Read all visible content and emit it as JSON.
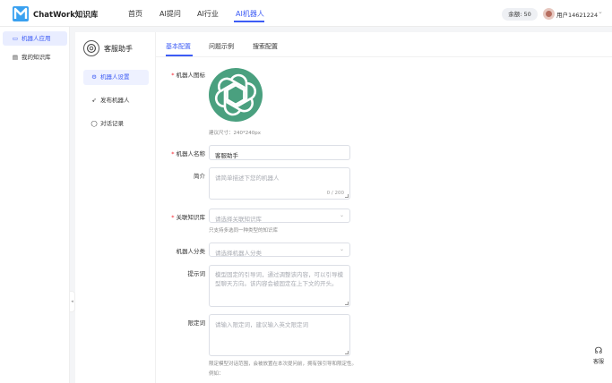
{
  "header": {
    "brand": "ChatWork知识库",
    "nav": [
      {
        "label": "首页",
        "active": false
      },
      {
        "label": "AI提问",
        "active": false
      },
      {
        "label": "AI行业",
        "active": false
      },
      {
        "label": "AI机器人",
        "active": true
      }
    ],
    "balance": "余额: 50",
    "username": "用户14621224"
  },
  "sidebar": {
    "items": [
      {
        "label": "机器人应用",
        "icon": "robot-app-icon",
        "active": true
      },
      {
        "label": "我的知识库",
        "icon": "document-icon",
        "active": false
      }
    ]
  },
  "robot_panel": {
    "name": "客服助手",
    "items": [
      {
        "label": "机器人设置",
        "icon": "gear-icon",
        "active": true
      },
      {
        "label": "发布机器人",
        "icon": "send-icon",
        "active": false
      },
      {
        "label": "对话记录",
        "icon": "chat-icon",
        "active": false
      }
    ]
  },
  "tabs": [
    {
      "label": "基本配置",
      "active": true
    },
    {
      "label": "问题示例",
      "active": false
    },
    {
      "label": "搜索配置",
      "active": false
    }
  ],
  "form": {
    "icon_label": "机器人图标",
    "icon_hint": "建议尺寸：240*240px",
    "name_label": "机器人名称",
    "name_value": "客服助手",
    "intro_label": "简介",
    "intro_placeholder": "请简单描述下您的机器人",
    "intro_counter": "0 / 200",
    "kb_label": "关联知识库",
    "kb_placeholder": "请选择关联知识库",
    "kb_hint": "只支持多选同一种类型的知识库",
    "category_label": "机器人分类",
    "category_placeholder": "请选择机器人分类",
    "prompt_label": "提示词",
    "prompt_placeholder": "模型固定的引导词，通过调整该内容，可以引导模型聊天方向。该内容会被固定在上下文的开头。",
    "limit_label": "限定词",
    "limit_placeholder": "请输入限定词，建议输入英文限定词",
    "limit_hint": "限定模型对话范围，会被放置在本次提问前，拥有强引导和限定性。",
    "limit_example": "例如："
  },
  "service": {
    "label": "客服"
  },
  "colors": {
    "accent": "#3d5cf5",
    "required": "#f5222d",
    "bot_icon": "#4aa07f"
  }
}
